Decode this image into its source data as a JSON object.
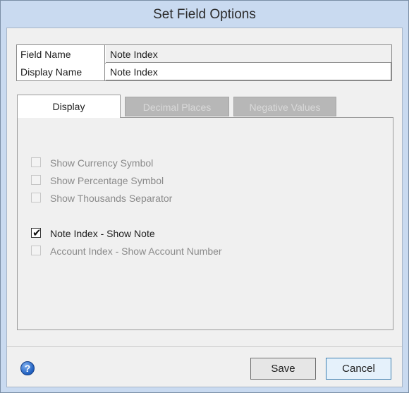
{
  "window": {
    "title": "Set Field Options"
  },
  "fields": [
    {
      "label": "Field Name",
      "value": "Note Index"
    },
    {
      "label": "Display Name",
      "value": "Note Index"
    }
  ],
  "tabs": [
    {
      "label": "Display",
      "state": "active"
    },
    {
      "label": "Decimal Places",
      "state": "disabled"
    },
    {
      "label": "Negative Values",
      "state": "disabled"
    }
  ],
  "options": [
    {
      "label": "Show Currency Symbol",
      "checked": false,
      "enabled": false
    },
    {
      "label": "Show Percentage Symbol",
      "checked": false,
      "enabled": false
    },
    {
      "label": "Show Thousands Separator",
      "checked": false,
      "enabled": false
    },
    {
      "label": "Note Index - Show Note",
      "checked": true,
      "enabled": true
    },
    {
      "label": "Account Index - Show Account Number",
      "checked": false,
      "enabled": false
    }
  ],
  "footer": {
    "help_icon": "question-mark-icon",
    "save_label": "Save",
    "cancel_label": "Cancel"
  },
  "colors": {
    "titlebar": "#c9daf0",
    "client": "#f0f0f0",
    "disabled_tab": "#b7b7b7"
  }
}
